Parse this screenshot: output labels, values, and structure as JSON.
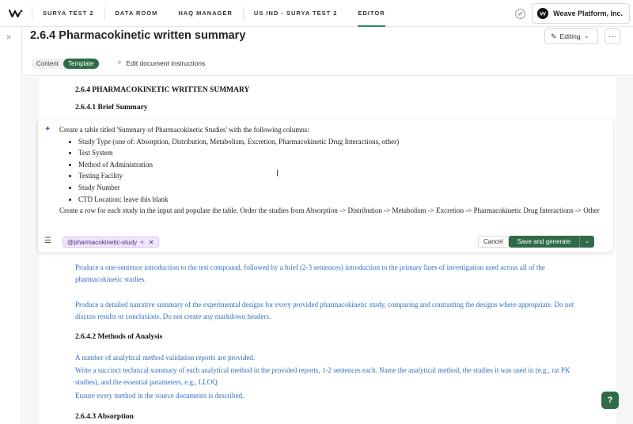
{
  "nav": {
    "items": [
      "SURYA TEST 2",
      "DATA ROOM",
      "HAQ MANAGER",
      "US IND - SURYA TEST 2",
      "EDITOR"
    ],
    "org_name": "Weave Platform, Inc."
  },
  "header": {
    "title": "2.6.4 Pharmacokinetic written summary",
    "editing_label": "Editing",
    "more_label": "···"
  },
  "subbar": {
    "tabs": [
      "Content",
      "Template"
    ],
    "instructions_label": "Edit document instructions"
  },
  "doc": {
    "h1": "2.6.4 PHARMACOKINETIC WRITTEN SUMMARY",
    "h2_brief": "2.6.4.1 Brief Summary",
    "para1": "Produce a one-sentence introduction to the test compound, followed by a brief (2-3 sentences) introduction to the primary lines of investigation used across all of the pharmacokinetic studies.",
    "para2": "Produce a detailed narrative summary of the experimental designs for every provided pharmacokinetic study, comparing and contrasting the designs where appropriate. Do not discuss results or conclusions. Do not create any markdown headers.",
    "h2_methods": "2.6.4.2 Methods of Analysis",
    "methods1": "A number of analytical method validation reports are provided.",
    "methods2": "Write a succinct technical summary of each analytical method in the provided reports, 1-2 sentences each. Name the analytical method, the studies it was used in (e.g., rat PK studies), and the essential parameters, e.g., LLOQ.",
    "methods3": "Ensure every method in the source documents is described.",
    "h2_absorption": "2.6.4.3 Absorption"
  },
  "prompt": {
    "intro": "Create a table titled 'Summary of Pharmacokinetic Studies' with the following columns:",
    "columns": [
      "Study Type (one of: Absorption, Distribution, Metabolism, Excretion, Pharmacokinetic Drug Interactions, other)",
      "Test System",
      "Method of Administration",
      "Testing Facility",
      "Study Number",
      "CTD Location: leave this blank"
    ],
    "outro": "Create a row for each study in the input and populate the table. Order the studies from Absorption -> Distribution -> Metabolism -> Excretion -> Pharmacokinetic Drug Interactions -> Other",
    "chip_label": "@pharmacokinetic-study",
    "cancel_label": "Cancel",
    "save_label": "Save and generate"
  },
  "colors": {
    "accent": "#2f6b49",
    "link_blue": "#2f6fbf",
    "ai_purple": "#7a4fc7"
  }
}
